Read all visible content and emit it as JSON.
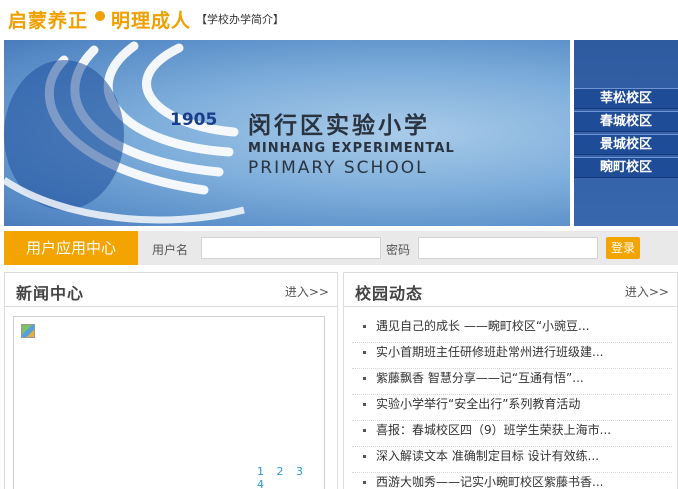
{
  "header": {
    "slogan_left": "启蒙养正",
    "slogan_right": "明理成人",
    "intro_link": "【学校办学简介】"
  },
  "banner": {
    "year": "1905",
    "school_name_cn": "闵行区实验小学",
    "school_name_en_line1": "MINHANG EXPERIMENTAL",
    "school_name_en_line2": "PRIMARY SCHOOL",
    "campuses": [
      "莘松校区",
      "春城校区",
      "景城校区",
      "畹町校区"
    ]
  },
  "user_center": {
    "title": "用户应用中心",
    "username_label": "用户名",
    "username_value": "",
    "password_label": "密码",
    "password_value": "",
    "login_label": "登录"
  },
  "news_center": {
    "title": "新闻中心",
    "more_label": "进入>>",
    "pages": [
      "1",
      "2",
      "3",
      "4"
    ]
  },
  "campus_news": {
    "title": "校园动态",
    "more_label": "进入>>",
    "items": [
      "遇见自己的成长 ——畹町校区“小豌豆...",
      "实小首期班主任研修班赴常州进行班级建...",
      "紫藤飘香 智慧分享——记“互通有悟”...",
      "实验小学举行“安全出行”系列教育活动",
      "喜报：春城校区四（9）班学生荣获上海市...",
      "深入解读文本 准确制定目标 设计有效练...",
      "西游大咖秀——记实小畹町校区紫藤书香..."
    ]
  },
  "colors": {
    "accent_orange": "#f4a400",
    "banner_blue": "#2e5aa0",
    "link_blue": "#2a9bd8"
  }
}
